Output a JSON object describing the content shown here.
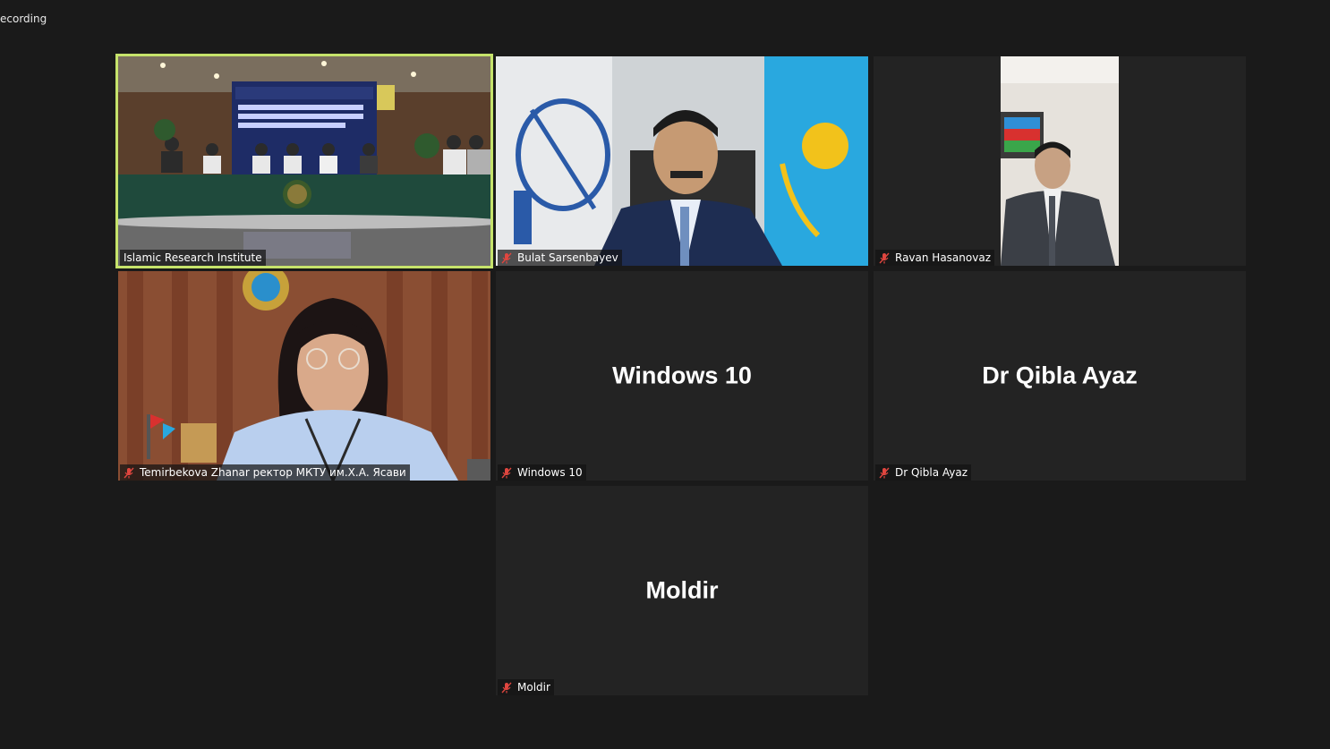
{
  "window": {
    "recording_label": "ecording"
  },
  "participants": [
    {
      "name": "Islamic Research Institute",
      "muted": false,
      "active": true,
      "has_video": true
    },
    {
      "name": "Bulat Sarsenbayev",
      "muted": true,
      "active": false,
      "has_video": true
    },
    {
      "name": "Ravan Hasanovaz",
      "muted": true,
      "active": false,
      "has_video": true
    },
    {
      "name": "Temirbekova Zhanar ректор МКТУ им.Х.А. Ясави",
      "muted": true,
      "active": false,
      "has_video": true
    },
    {
      "name": "Windows 10",
      "display_name": "Windows 10",
      "muted": true,
      "active": false,
      "has_video": false
    },
    {
      "name": "Dr Qibla Ayaz",
      "display_name": "Dr Qibla Ayaz",
      "muted": true,
      "active": false,
      "has_video": false
    },
    {
      "name": "Moldir",
      "display_name": "Moldir",
      "muted": true,
      "active": false,
      "has_video": false
    }
  ],
  "colors": {
    "background": "#1a1a1a",
    "tile": "#232323",
    "active_speaker": "#c6e36b",
    "muted_icon": "#e0463f"
  },
  "icons": {
    "muted": "microphone-muted-icon"
  }
}
